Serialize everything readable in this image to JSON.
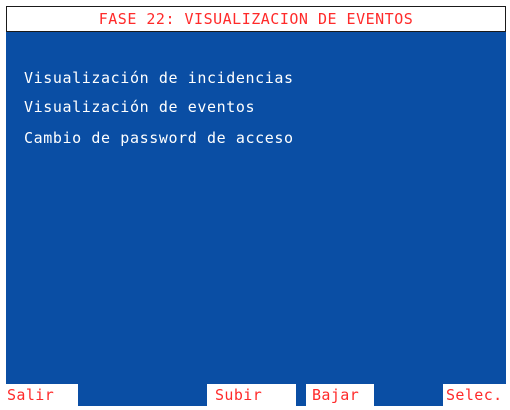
{
  "header": {
    "title": "FASE 22: VISUALIZACION DE EVENTOS"
  },
  "menu": {
    "items": [
      {
        "label": "Visualización de incidencias"
      },
      {
        "label": "Visualización de eventos"
      },
      {
        "label": "Cambio de password de acceso"
      }
    ]
  },
  "function_keys": {
    "salir": "Salir",
    "subir": "Subir",
    "bajar": "Bajar",
    "selec": "Selec."
  },
  "colors": {
    "background_blue": "#0a4ea4",
    "title_red": "#ff2a2a",
    "menu_text": "#ffffff",
    "key_background": "#ffffff"
  }
}
